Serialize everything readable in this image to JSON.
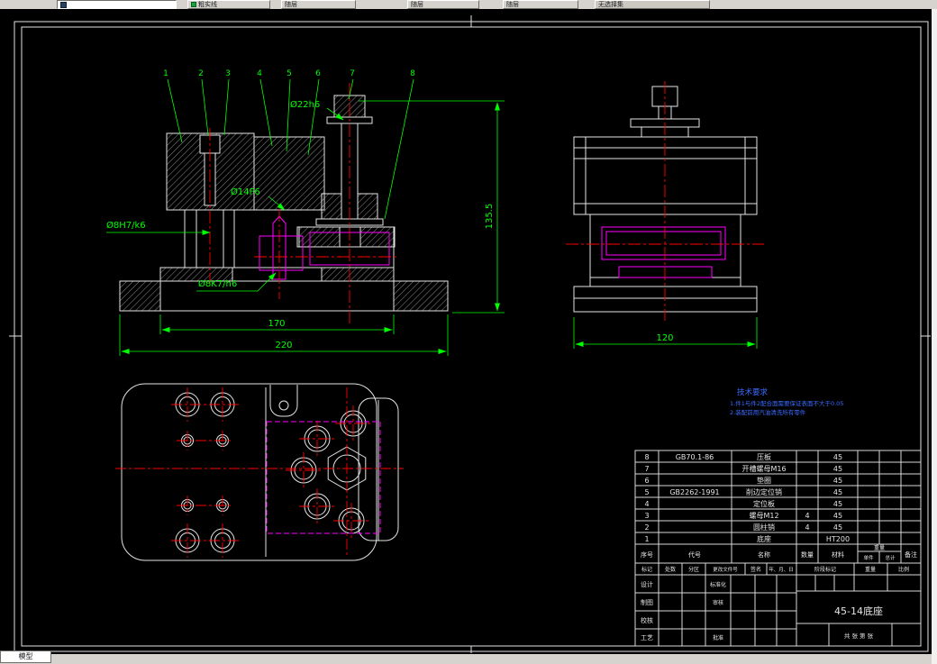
{
  "toolbar": {
    "combos": [
      {
        "label": ""
      },
      {
        "label": "粗实线"
      },
      {
        "label": "随层"
      },
      {
        "label": "随层"
      },
      {
        "label": "随层"
      },
      {
        "label": "无选择集"
      }
    ]
  },
  "statusbar": {
    "model_tab": "模型"
  },
  "colors": {
    "dimension": "#00ff00",
    "centerline": "#ff0000",
    "hidden": "#ff00ff",
    "note": "#3a6bff",
    "geometry": "#e4e4e4"
  },
  "drawing": {
    "part_numbers": [
      "1",
      "2",
      "3",
      "4",
      "5",
      "6",
      "7",
      "8"
    ],
    "dims": {
      "d22": "Ø22h6",
      "d14": "Ø14F6",
      "d8h7": "Ø8H7/k6",
      "d8k7": "Ø8K7/h6",
      "h1355": "135.5",
      "w170": "170",
      "w220": "220",
      "w120": "120"
    },
    "notes": {
      "title": "技术要求",
      "line1": "1.件1与件2配合面需要保证表面不大于0.05",
      "line2": "2.装配前用汽油清洗所有零件"
    },
    "bom": {
      "headers": {
        "no": "序号",
        "code": "代号",
        "name": "名称",
        "qty": "数量",
        "material": "材料",
        "weight": "重量",
        "unit": "单件",
        "total": "总计",
        "remark": "备注"
      },
      "rows": [
        {
          "no": "8",
          "code": "GB70.1-86",
          "name": "压板",
          "qty": "",
          "material": "45"
        },
        {
          "no": "7",
          "code": "",
          "name": "开槽螺母M16",
          "qty": "",
          "material": "45"
        },
        {
          "no": "6",
          "code": "",
          "name": "垫圈",
          "qty": "",
          "material": "45"
        },
        {
          "no": "5",
          "code": "GB2262-1991",
          "name": "削边定位销",
          "qty": "",
          "material": "45"
        },
        {
          "no": "4",
          "code": "",
          "name": "定位板",
          "qty": "",
          "material": "45"
        },
        {
          "no": "3",
          "code": "",
          "name": "螺母M12",
          "qty": "4",
          "material": "45"
        },
        {
          "no": "2",
          "code": "",
          "name": "圆柱销",
          "qty": "4",
          "material": "45"
        },
        {
          "no": "1",
          "code": "",
          "name": "底座",
          "qty": "",
          "material": "HT200"
        }
      ]
    },
    "title_block": {
      "top_row": [
        "标记",
        "处数",
        "分区",
        "更改文件号",
        "签名",
        "年、月、日"
      ],
      "col_a": [
        "设计",
        "制图",
        "校核",
        "工艺"
      ],
      "col_b": [
        "标准化",
        "审核",
        "",
        "批准"
      ],
      "stage": "阶段标记",
      "weight": "重量",
      "scale": "比例",
      "sheets": "共 张 第 张",
      "drawing_no": "45-14底座"
    }
  }
}
